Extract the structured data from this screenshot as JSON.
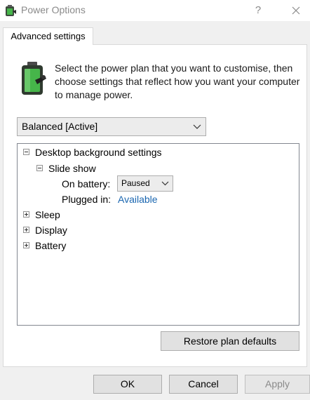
{
  "window": {
    "title": "Power Options",
    "help_label": "?",
    "close_icon": "close-icon",
    "app_icon": "power-options-icon"
  },
  "tab": {
    "label": "Advanced settings"
  },
  "intro": {
    "icon": "battery-plan-icon",
    "text": "Select the power plan that you want to customise, then choose settings that reflect how you want your computer to manage power."
  },
  "plan_select": {
    "value": "Balanced [Active]"
  },
  "tree": {
    "desktop_background": "Desktop background settings",
    "slide_show": "Slide show",
    "on_battery_label": "On battery:",
    "on_battery_value": "Paused",
    "plugged_in_label": "Plugged in:",
    "plugged_in_value": "Available",
    "sleep": "Sleep",
    "display": "Display",
    "battery": "Battery"
  },
  "buttons": {
    "restore": "Restore plan defaults",
    "ok": "OK",
    "cancel": "Cancel",
    "apply": "Apply"
  },
  "colors": {
    "link_blue": "#1a66b0",
    "battery_green": "#46b54a"
  }
}
